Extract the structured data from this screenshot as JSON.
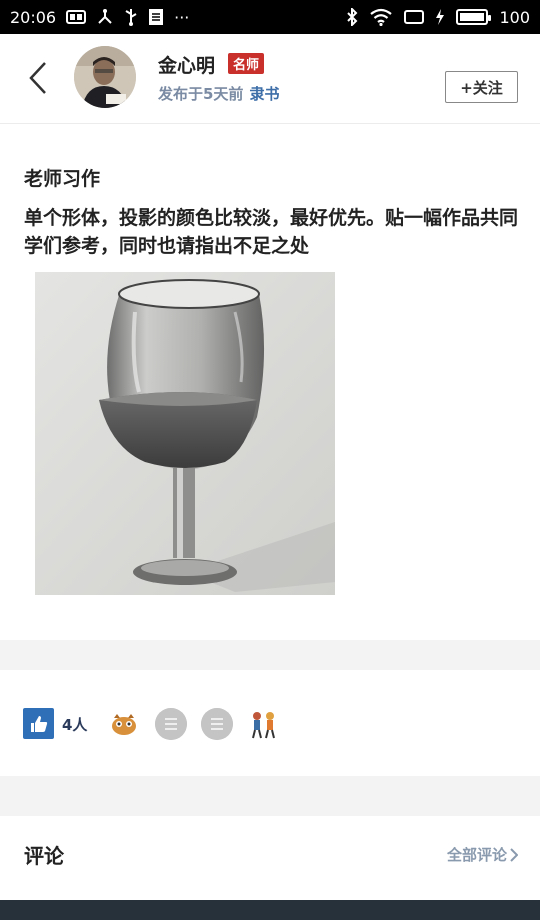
{
  "status_bar": {
    "time": "20:06",
    "more": "···",
    "battery": "100"
  },
  "header": {
    "author_name": "金心明",
    "badge": "名师",
    "published": "发布于5天前",
    "category": "隶书",
    "follow_label": "+关注"
  },
  "post": {
    "title": "老师习作",
    "body": "单个形体，投影的颜色比较淡，最好优先。贴一幅作品共同学们参考，同时也请指出不足之处"
  },
  "likes": {
    "count": "4人"
  },
  "comments": {
    "title": "评论",
    "all_label": "全部评论"
  },
  "colors": {
    "accent_blue": "#2f6fb8",
    "badge_red": "#c9302c",
    "link_blue": "#3d6ea8",
    "meta_gray": "#7a8ba3",
    "section_gap": "#f3f3f3"
  }
}
